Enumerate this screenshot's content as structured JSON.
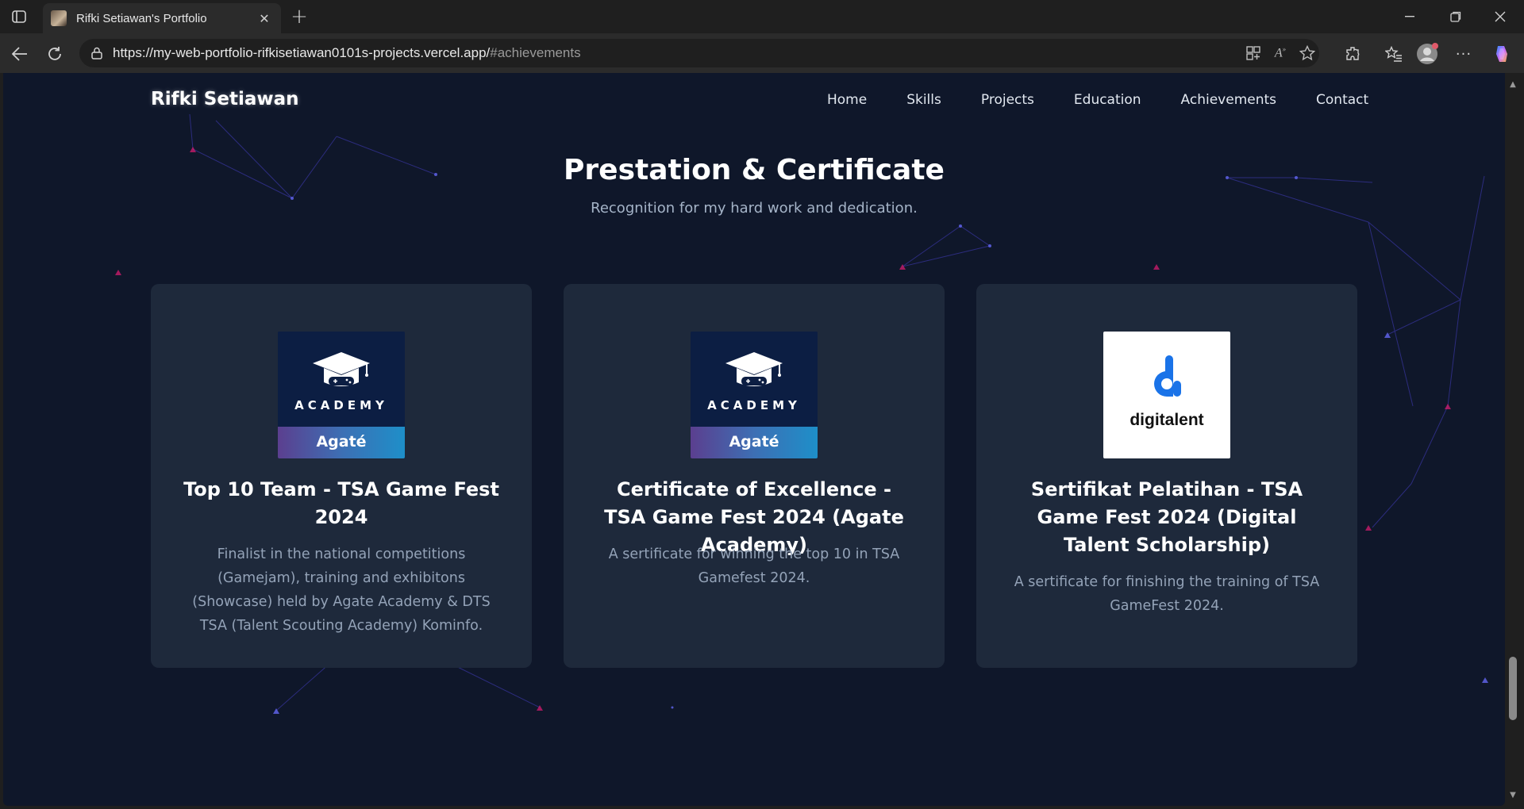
{
  "browser": {
    "tab_title": "Rifki Setiawan's Portfolio",
    "url_host": "https://my-web-portfolio-rifkisetiawan0101s-projects.vercel.app/",
    "url_path": "#achievements"
  },
  "site": {
    "brand": "Rifki Setiawan",
    "nav": [
      "Home",
      "Skills",
      "Projects",
      "Education",
      "Achievements",
      "Contact"
    ]
  },
  "section": {
    "title": "Prestation & Certificate",
    "subtitle": "Recognition for my hard work and dedication."
  },
  "cards": [
    {
      "logo": "agate-academy",
      "logo_word": "ACADEMY",
      "logo_band": "Agaté",
      "title": "Top 10 Team - TSA Game Fest 2024",
      "description": "Finalist in the national competitions (Gamejam), training and exhibitons (Showcase) held by Agate Academy & DTS TSA (Talent Scouting Academy) Kominfo."
    },
    {
      "logo": "agate-academy",
      "logo_word": "ACADEMY",
      "logo_band": "Agaté",
      "title": "Certificate of Excellence - TSA Game Fest 2024 (Agate Academy)",
      "description": "A sertificate for winning the top 10 in TSA Gamefest 2024."
    },
    {
      "logo": "digitalent",
      "logo_word": "digitalent",
      "title": "Sertifikat Pelatihan - TSA Game Fest 2024 (Digital Talent Scholarship)",
      "description": "A sertificate for finishing the training of TSA GameFest 2024."
    }
  ],
  "colors": {
    "page_bg": "#0f172a",
    "card_bg": "#1e293b",
    "text_muted": "#94a3b8"
  }
}
